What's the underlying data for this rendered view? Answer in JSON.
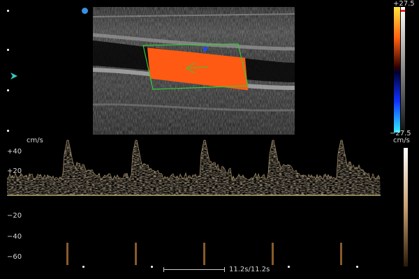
{
  "color_scale": {
    "max_label": "+27.5",
    "min_label": "−27.5"
  },
  "velocity_unit_right": "cm/s",
  "doppler": {
    "unit": "cm/s",
    "tick_labels": [
      "+40",
      "+20",
      "−20",
      "−40",
      "−60"
    ],
    "time_readout": "11.2s/11.2s"
  },
  "icons": {
    "probe_orientation": "orientation-dot-icon",
    "focus_marker": "focus-arrow-icon"
  },
  "colors": {
    "flow": "#ff5a14",
    "roi_box": "#37c837",
    "focus_marker": "#38c9c0",
    "orientation_dot": "#3a8fe0",
    "spectrum": "#c7a06b",
    "baseline": "#d8cc88"
  }
}
